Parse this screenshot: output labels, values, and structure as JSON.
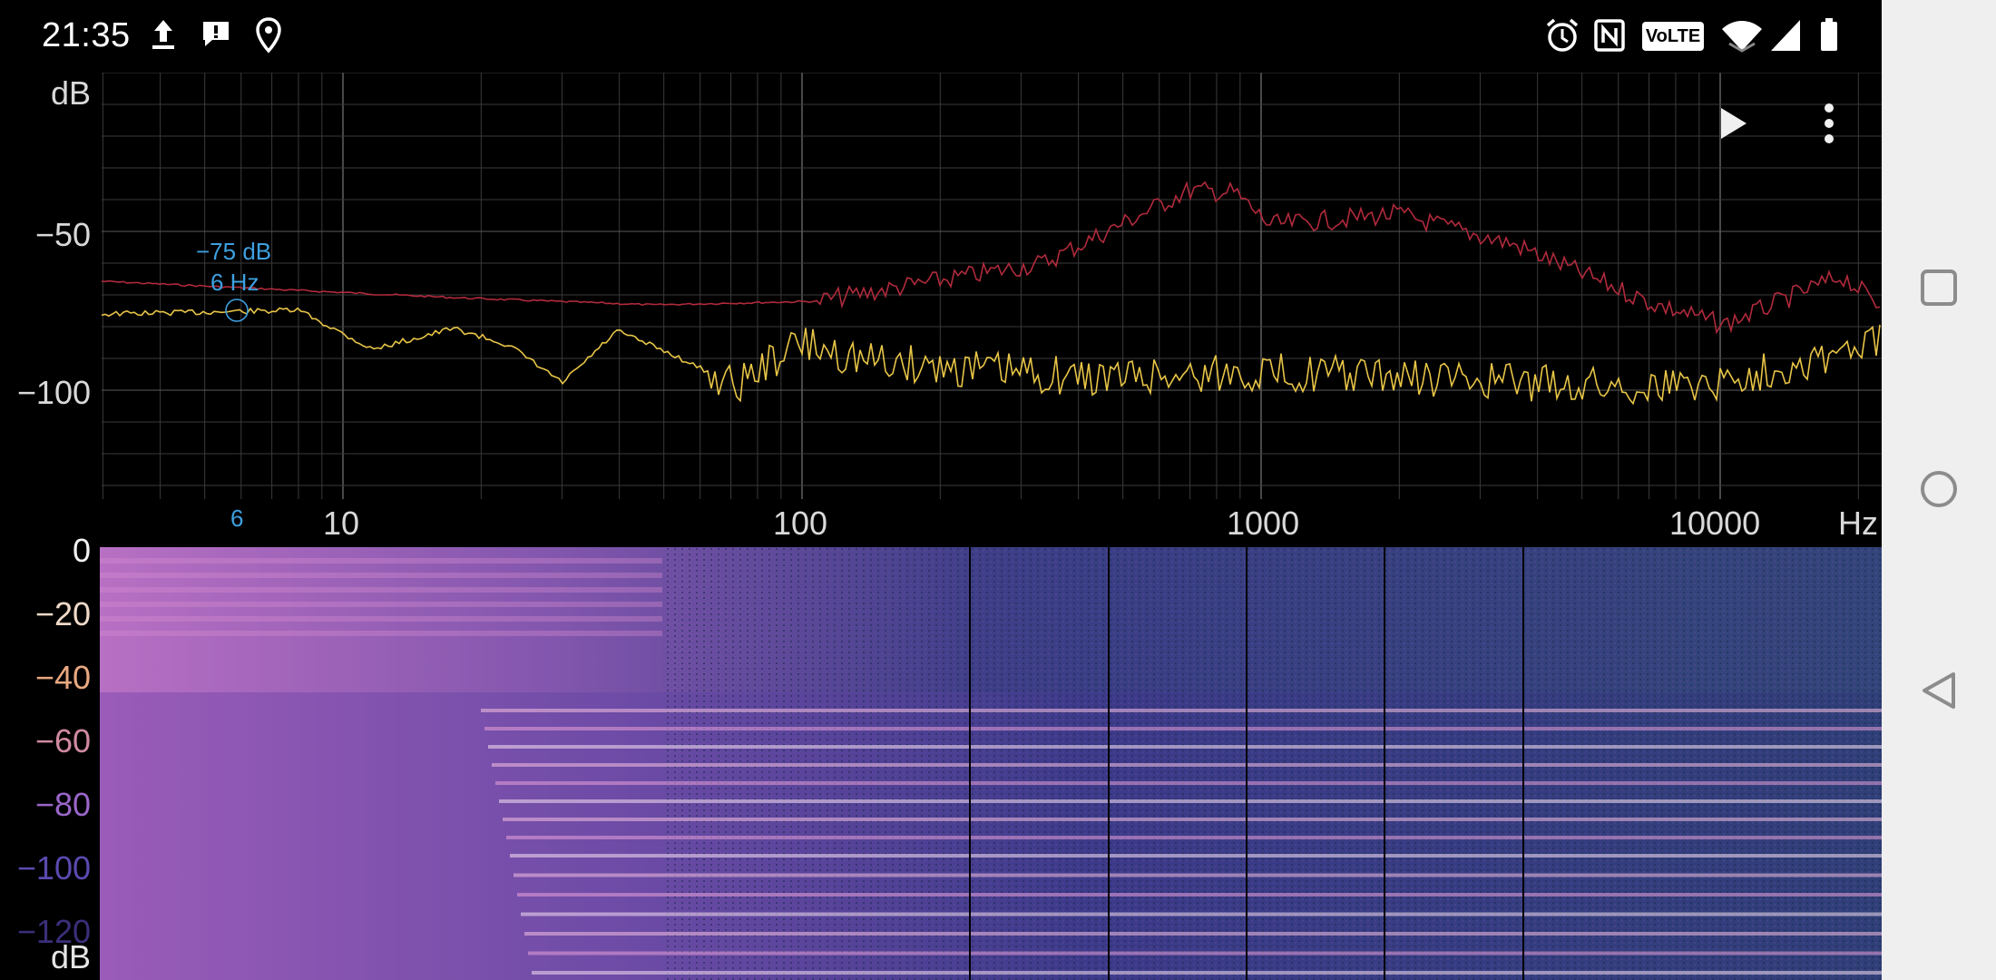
{
  "status_bar": {
    "time": "21:35",
    "left_icons": [
      "upload-icon",
      "message-icon",
      "location-icon"
    ],
    "right_icons": [
      "alarm-icon",
      "nfc-icon",
      "volte-badge",
      "wifi-icon",
      "signal-icon",
      "battery-icon"
    ],
    "volte_label": "VoLTE"
  },
  "spectrum": {
    "y_unit": "dB",
    "y_ticks": [
      "−50",
      "−100"
    ],
    "x_unit": "Hz",
    "x_ticks": [
      "10",
      "100",
      "1000",
      "10000"
    ],
    "cursor": {
      "db_label": "−75 dB",
      "hz_label": "6 Hz",
      "axis_marker": "6"
    },
    "colors": {
      "peak_trace": "#b02a3c",
      "live_trace": "#e8c547",
      "cursor": "#3ea0e0",
      "grid": "#3a3a3a"
    }
  },
  "spectrogram": {
    "y_unit": "dB",
    "y_ticks": [
      "0",
      "−20",
      "−40",
      "−60",
      "−80",
      "−100",
      "−120"
    ],
    "tick_colors": [
      "#f2f2f2",
      "#f0d9c8",
      "#e8a880",
      "#d08aa0",
      "#9a66c8",
      "#5a4ab0",
      "#3a2f7a"
    ]
  },
  "controls": {
    "play_icon": "play-icon",
    "menu_icon": "more-vert-icon"
  },
  "navigation": {
    "buttons": [
      "recents-button",
      "home-button",
      "back-button"
    ]
  }
}
